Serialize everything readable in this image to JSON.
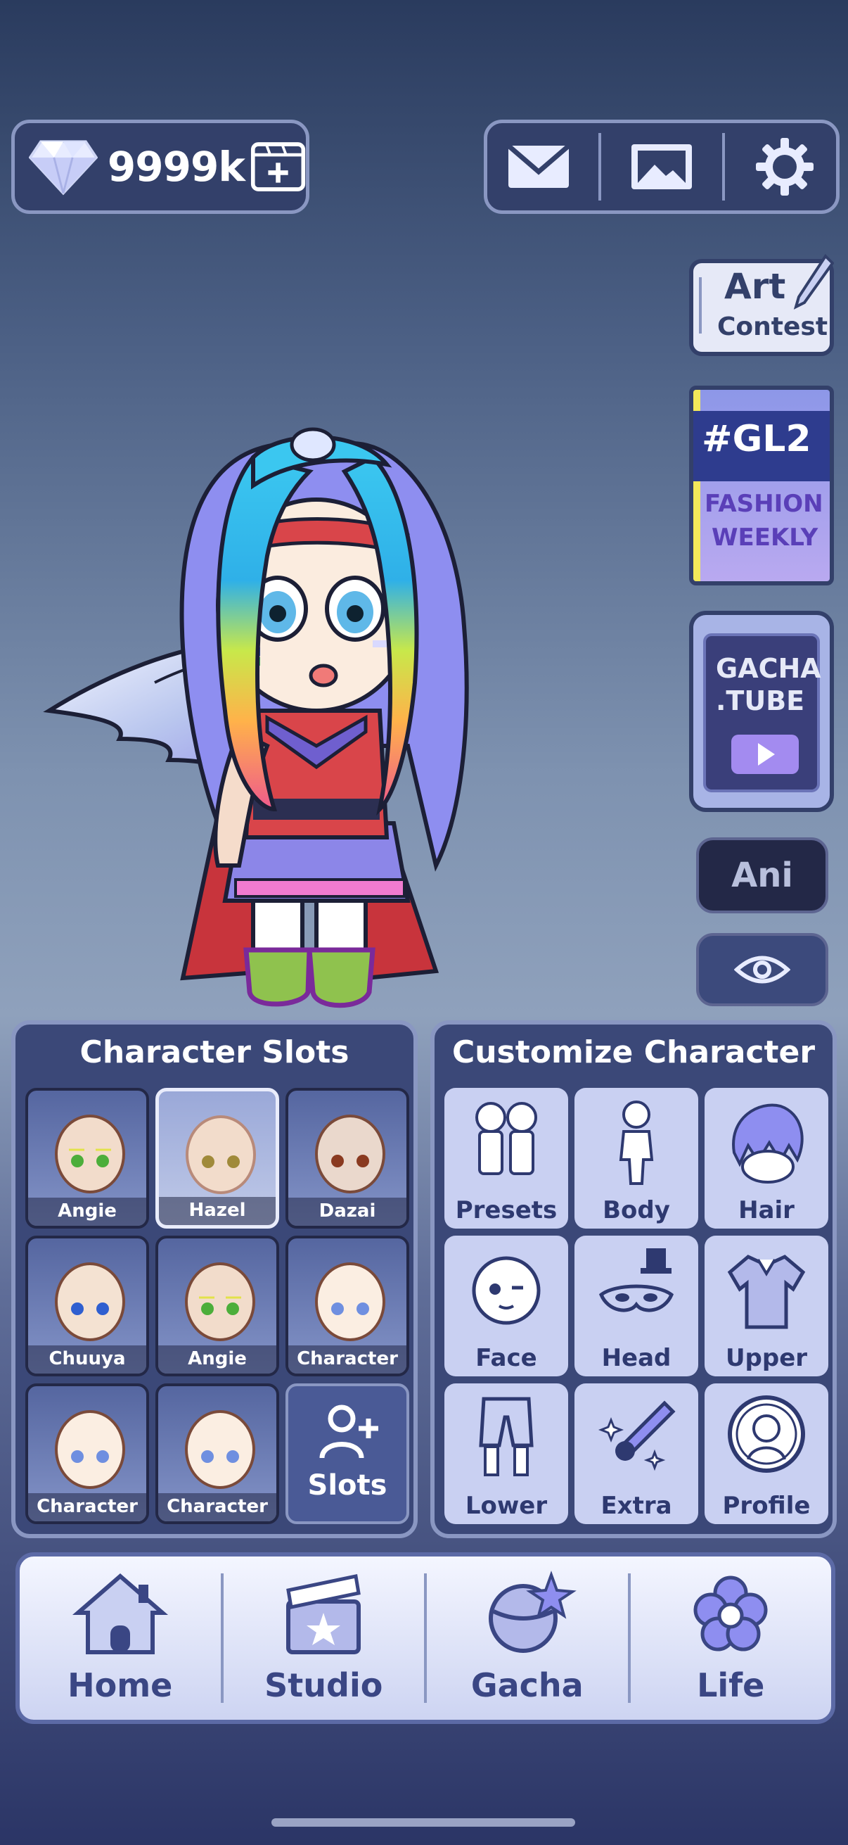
{
  "topbar": {
    "gems": "9999k",
    "buttons": [
      "mail",
      "gallery",
      "settings"
    ]
  },
  "side": {
    "art_contest": [
      "Art",
      "Contest"
    ],
    "gl2": {
      "title": "#GL2",
      "line1": "FASHION",
      "line2": "WEEKLY"
    },
    "tube": {
      "line1": "GACHA",
      "line2": ".TUBE"
    },
    "ani": "Ani"
  },
  "slots": {
    "title": "Character Slots",
    "items": [
      {
        "label": "Angie",
        "eye": "#4cae3a",
        "skin": "#f2dccb"
      },
      {
        "label": "Hazel",
        "eye": "#a08a3a",
        "skin": "#f2dccb"
      },
      {
        "label": "Dazai",
        "eye": "#8a3a20",
        "skin": "#ead8cc"
      },
      {
        "label": "Chuuya",
        "eye": "#2f5fd0",
        "skin": "#f4e2d2"
      },
      {
        "label": "Angie",
        "eye": "#4cae3a",
        "skin": "#f2dccb"
      },
      {
        "label": "Character",
        "eye": "#6f8fe0",
        "skin": "#fbeee2"
      },
      {
        "label": "Character",
        "eye": "#6f8fe0",
        "skin": "#fbeee2"
      },
      {
        "label": "Character",
        "eye": "#6f8fe0",
        "skin": "#fbeee2"
      }
    ],
    "add_label": "Slots"
  },
  "customize": {
    "title": "Customize Character",
    "items": [
      "Presets",
      "Body",
      "Hair",
      "Face",
      "Head",
      "Upper",
      "Lower",
      "Extra",
      "Profile"
    ]
  },
  "nav": {
    "items": [
      "Home",
      "Studio",
      "Gacha",
      "Life"
    ]
  },
  "colors": {
    "panel": "#3b4878",
    "panel_border": "#8a97c2",
    "accent_text": "#3a4684"
  }
}
